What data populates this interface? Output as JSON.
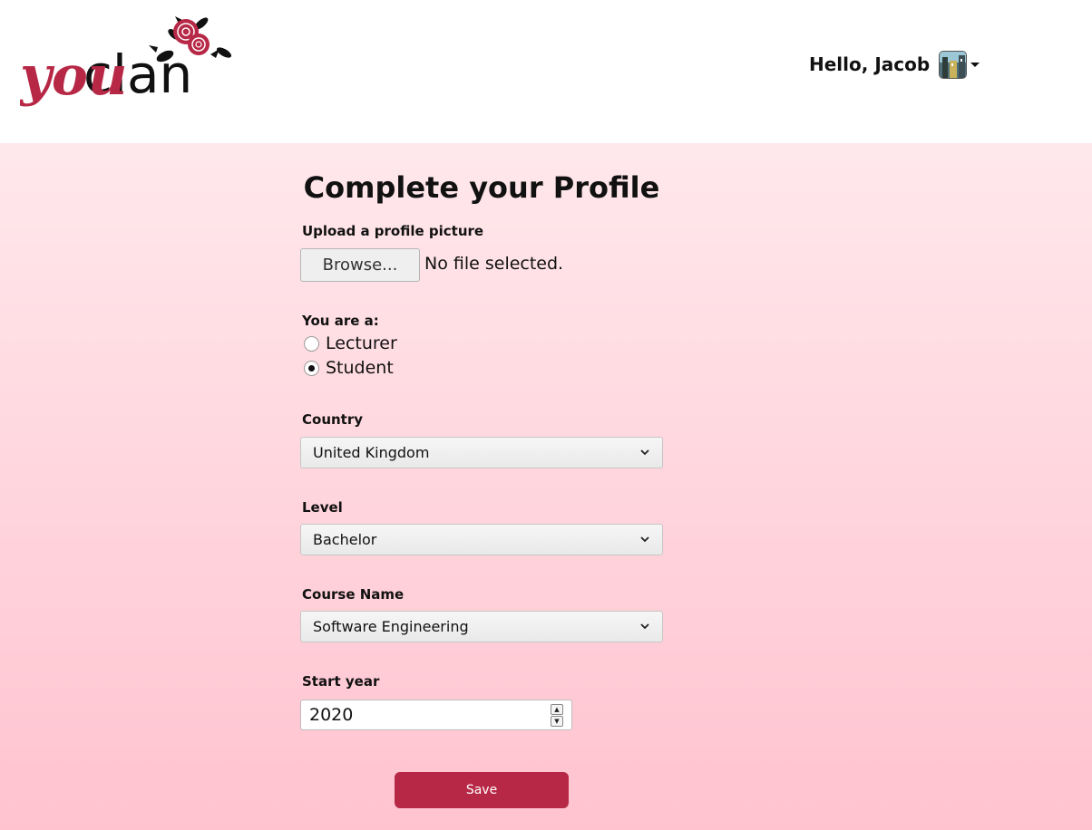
{
  "brand": {
    "logo_text_you": "you",
    "logo_text_clan": "clan",
    "accent_color": "#b72846"
  },
  "header": {
    "greeting": "Hello, Jacob",
    "avatar_icon": "user-avatar-image",
    "menu_icon": "caret-down-icon"
  },
  "form": {
    "title": "Complete your Profile",
    "upload": {
      "label": "Upload a profile picture",
      "button_label": "Browse...",
      "status": "No file selected."
    },
    "role": {
      "label": "You are a:",
      "options": [
        {
          "label": "Lecturer",
          "checked": false
        },
        {
          "label": "Student",
          "checked": true
        }
      ]
    },
    "country": {
      "label": "Country",
      "value": "United Kingdom"
    },
    "level": {
      "label": "Level",
      "value": "Bachelor"
    },
    "course": {
      "label": "Course Name",
      "value": "Software Engineering"
    },
    "start_year": {
      "label": "Start year",
      "value": "2020"
    },
    "save_label": "Save"
  }
}
